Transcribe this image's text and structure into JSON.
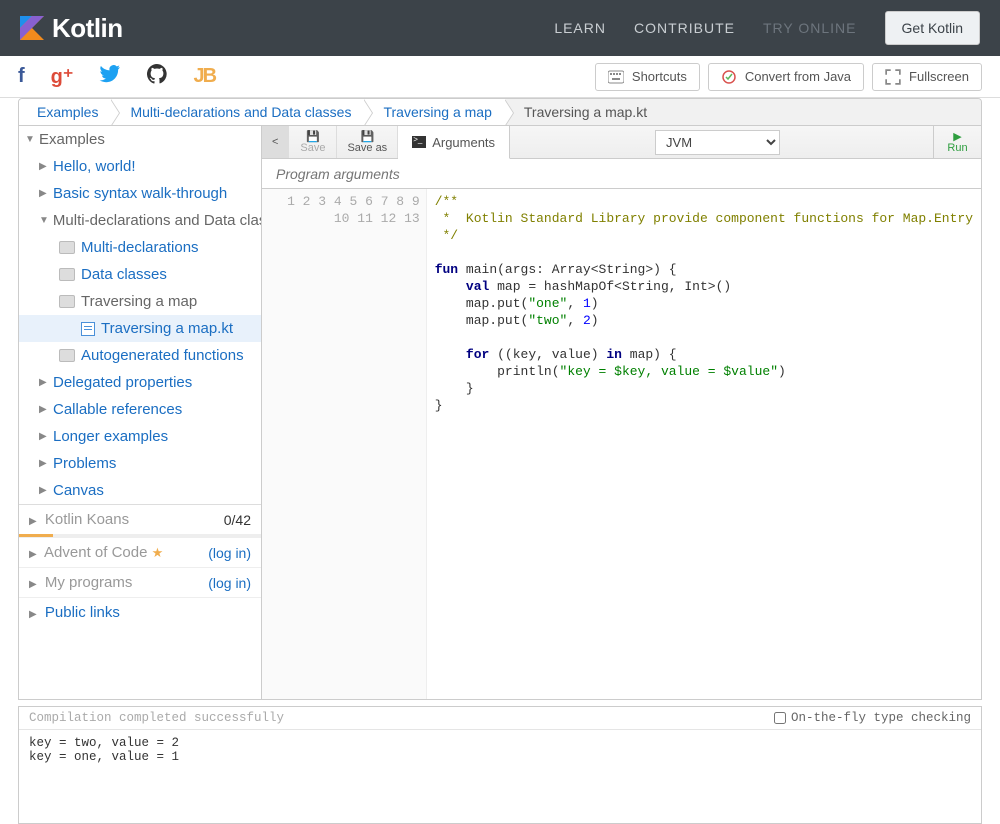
{
  "header": {
    "brand": "Kotlin",
    "nav": {
      "learn": "LEARN",
      "contribute": "CONTRIBUTE",
      "try_online": "TRY ONLINE"
    },
    "get_kotlin": "Get Kotlin"
  },
  "tools": {
    "shortcuts": "Shortcuts",
    "convert": "Convert from Java",
    "fullscreen": "Fullscreen"
  },
  "breadcrumbs": [
    "Examples",
    "Multi-declarations and Data classes",
    "Traversing a map",
    "Traversing a map.kt"
  ],
  "sidebar": {
    "examples": "Examples",
    "items": {
      "hello": "Hello, world!",
      "basic": "Basic syntax walk-through",
      "multi": "Multi-declarations and Data classes",
      "multi_children": {
        "md": "Multi-declarations",
        "dc": "Data classes",
        "tm": "Traversing a map",
        "tmkt": "Traversing a map.kt",
        "ag": "Autogenerated functions"
      },
      "delegated": "Delegated properties",
      "callable": "Callable references",
      "longer": "Longer examples",
      "problems": "Problems",
      "canvas": "Canvas"
    },
    "koans": {
      "label": "Kotlin Koans",
      "count": "0/42"
    },
    "advent": {
      "label": "Advent of Code",
      "login": "(log in)"
    },
    "myprograms": {
      "label": "My programs",
      "login": "(log in)"
    },
    "public": "Public links"
  },
  "editor": {
    "back": "<",
    "save": "Save",
    "saveas": "Save as",
    "arguments": "Arguments",
    "target": "JVM",
    "run": "Run",
    "args_placeholder": "Program arguments",
    "lines_count": 13,
    "code": {
      "l1": "/**",
      "l2": " *  Kotlin Standard Library provide component functions for Map.Entry",
      "l3": " */",
      "l4": "",
      "l5a": "fun",
      "l5b": " main(args: Array<String>) {",
      "l6a": "    ",
      "l6b": "val",
      "l6c": " map = hashMapOf<String, Int>()",
      "l7a": "    map.put(",
      "l7b": "\"one\"",
      "l7c": ", ",
      "l7d": "1",
      "l7e": ")",
      "l8a": "    map.put(",
      "l8b": "\"two\"",
      "l8c": ", ",
      "l8d": "2",
      "l8e": ")",
      "l9": "",
      "l10a": "    ",
      "l10b": "for",
      "l10c": " ((key, value) ",
      "l10d": "in",
      "l10e": " map) {",
      "l11a": "        println(",
      "l11b": "\"key = ",
      "l11c": "$key",
      "l11d": ", value = ",
      "l11e": "$value",
      "l11f": "\"",
      "l11g": ")",
      "l12": "    }",
      "l13": "}"
    }
  },
  "output": {
    "status": "Compilation completed successfully",
    "typecheck": "On-the-fly type checking",
    "lines": "key = two, value = 2\nkey = one, value = 1"
  }
}
